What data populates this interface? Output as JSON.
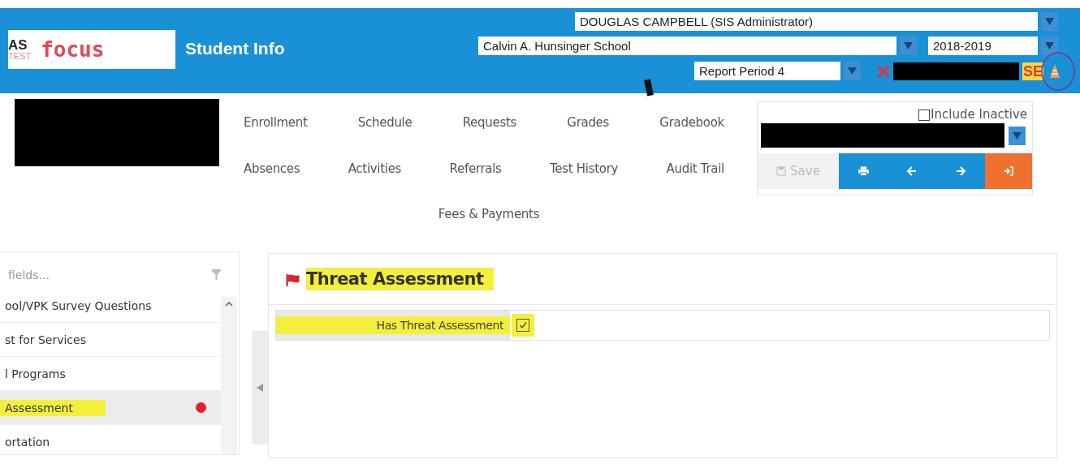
{
  "header": {
    "logo": {
      "mark": "AS",
      "sub": "TEST",
      "name": "focus"
    },
    "title": "Student Info",
    "user": "DOUGLAS CAMPBELL (SIS Administrator)",
    "school": "Calvin A. Hunsinger School",
    "year": "2018-2019",
    "period": "Report Period 4",
    "tag": "SE"
  },
  "nav": [
    {
      "label": "Enrollment"
    },
    {
      "label": "Schedule"
    },
    {
      "label": "Requests"
    },
    {
      "label": "Grades"
    },
    {
      "label": "Gradebook"
    },
    {
      "label": "Absences"
    },
    {
      "label": "Activities"
    },
    {
      "label": "Referrals"
    },
    {
      "label": "Test History"
    },
    {
      "label": "Audit Trail"
    },
    {
      "label": "Fees & Payments"
    }
  ],
  "student_panel": {
    "include_inactive": {
      "label": "Include Inactive",
      "checked": false
    },
    "save": {
      "label": "Save",
      "disabled": true
    }
  },
  "sidebar": {
    "search": {
      "placeholder": "fields..."
    },
    "items": [
      {
        "label": "ool/VPK Survey Questions",
        "selected": false,
        "highlighted": false
      },
      {
        "label": "st for Services",
        "selected": false,
        "highlighted": false
      },
      {
        "label": "l Programs",
        "selected": false,
        "highlighted": false
      },
      {
        "label": "Assessment",
        "selected": true,
        "highlighted": true,
        "color": "#e0202a"
      },
      {
        "label": "ortation",
        "selected": false,
        "highlighted": false
      }
    ]
  },
  "section": {
    "title": "Threat Assessment",
    "highlighted": true,
    "fields": [
      {
        "label": "Has Threat Assessment",
        "checked": true,
        "highlighted": true
      }
    ]
  }
}
